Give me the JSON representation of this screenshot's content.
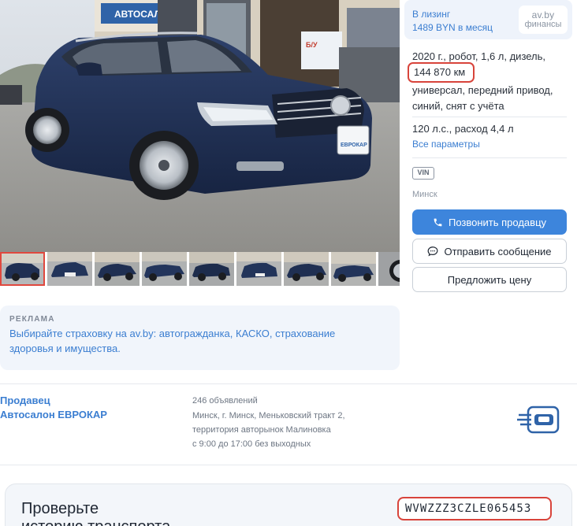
{
  "listing": {
    "dealer_sign_text": "АВТОСАЛОН",
    "plate_sticker": "ЕВРОКАР",
    "window_sign_text": "Б/У"
  },
  "leasing": {
    "title": "В лизинг",
    "price": "1489 BYN в месяц",
    "partner_logo_line1": "av.by",
    "partner_logo_line2": "финансы"
  },
  "specs": {
    "line1": "2020 г., робот, 1,6 л, дизель,",
    "mileage": "144 870 км",
    "line2": "универсал, передний привод, синий, снят с учёта",
    "line3": "120 л.с., расход 4,4 л",
    "all_params_link": "Все параметры",
    "vin_badge": "VIN",
    "city": "Минск"
  },
  "actions": {
    "call": "Позвонить продавцу",
    "message": "Отправить сообщение",
    "offer_price": "Предложить цену"
  },
  "ad": {
    "tag": "РЕКЛАМА",
    "text": "Выбирайте страховку на av.by: автогражданка, КАСКО, страхование здоровья и имущества."
  },
  "seller": {
    "label": "Продавец",
    "name": "Автосалон ЕВРОКАР",
    "ads_count": "246 объявлений",
    "address_line1": "Минск, г. Минск, Меньковский тракт 2,",
    "address_line2": "территория авторынок Малиновка",
    "hours": "с 9:00 до 17:00 без выходных"
  },
  "history": {
    "title_line1": "Проверьте",
    "title_line2": "историю транспорта",
    "vin": "WVWZZZ3CZLE065453"
  },
  "colors": {
    "accent_blue": "#3d85dc",
    "link_blue": "#3b7ed1",
    "highlight_red": "#d8443b",
    "car_body": "#1f2f52"
  },
  "thumbnails": [
    {
      "id": "t1"
    },
    {
      "id": "t2"
    },
    {
      "id": "t3"
    },
    {
      "id": "t4"
    },
    {
      "id": "t5"
    },
    {
      "id": "t6"
    },
    {
      "id": "t7"
    },
    {
      "id": "t8"
    },
    {
      "id": "t9"
    }
  ]
}
